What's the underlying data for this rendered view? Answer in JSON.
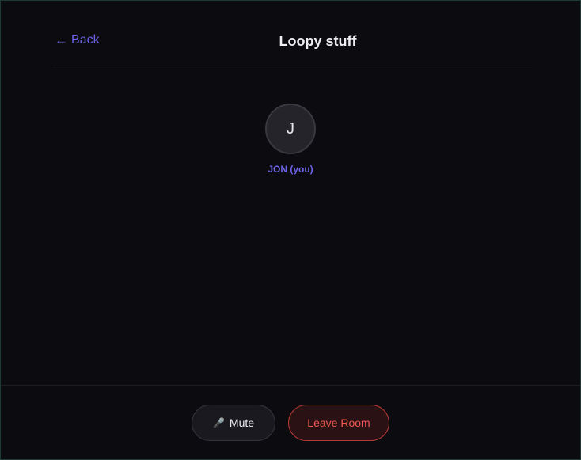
{
  "header": {
    "back_arrow": "←",
    "back_label": "Back",
    "title": "Loopy stuff"
  },
  "participants": [
    {
      "initial": "J",
      "name": "JON (you)"
    }
  ],
  "footer": {
    "mute_icon": "🎤",
    "mute_label": "Mute",
    "leave_label": "Leave Room"
  },
  "colors": {
    "background": "#0c0b0f",
    "accent": "#6c63e6",
    "danger": "#ee5a52"
  }
}
